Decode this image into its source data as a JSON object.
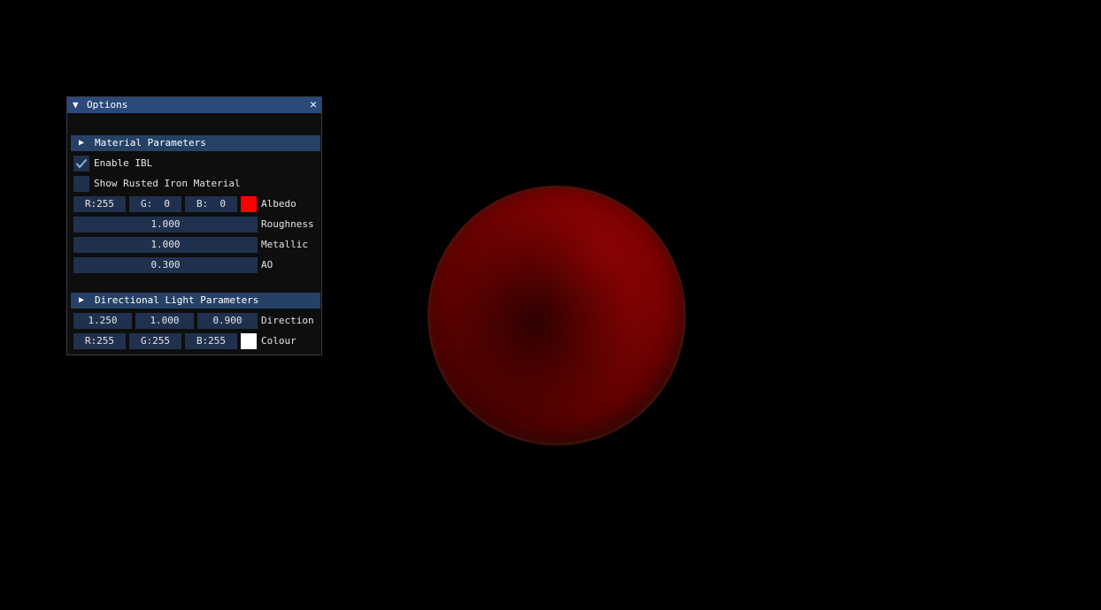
{
  "window": {
    "title": "Options",
    "collapse_icon": "triangle-down-icon",
    "close_icon": "close-icon",
    "close_glyph": "✕"
  },
  "material": {
    "header": "Material Parameters",
    "header_icon": "triangle-right-icon",
    "enable_ibl": {
      "label": "Enable IBL",
      "checked": true
    },
    "rusted_iron": {
      "label": "Show Rusted Iron Material",
      "checked": false
    },
    "albedo": {
      "r": "R:255",
      "g": "G:  0",
      "b": "B:  0",
      "label": "Albedo",
      "color": "#ff0000"
    },
    "roughness": {
      "value": "1.000",
      "label": "Roughness"
    },
    "metallic": {
      "value": "1.000",
      "label": "Metallic"
    },
    "ao": {
      "value": "0.300",
      "label": "AO"
    }
  },
  "light": {
    "header": "Directional Light Parameters",
    "header_icon": "triangle-right-icon",
    "direction": {
      "x": "1.250",
      "y": "1.000",
      "z": "0.900",
      "label": "Direction"
    },
    "colour": {
      "r": "R:255",
      "g": "G:255",
      "b": "B:255",
      "label": "Colour",
      "color": "#ffffff"
    }
  },
  "colors": {
    "title_bar": "#294a7a",
    "header_bg": "#264166",
    "frame_bg": "#1f314e",
    "sphere": "#7a0202"
  }
}
